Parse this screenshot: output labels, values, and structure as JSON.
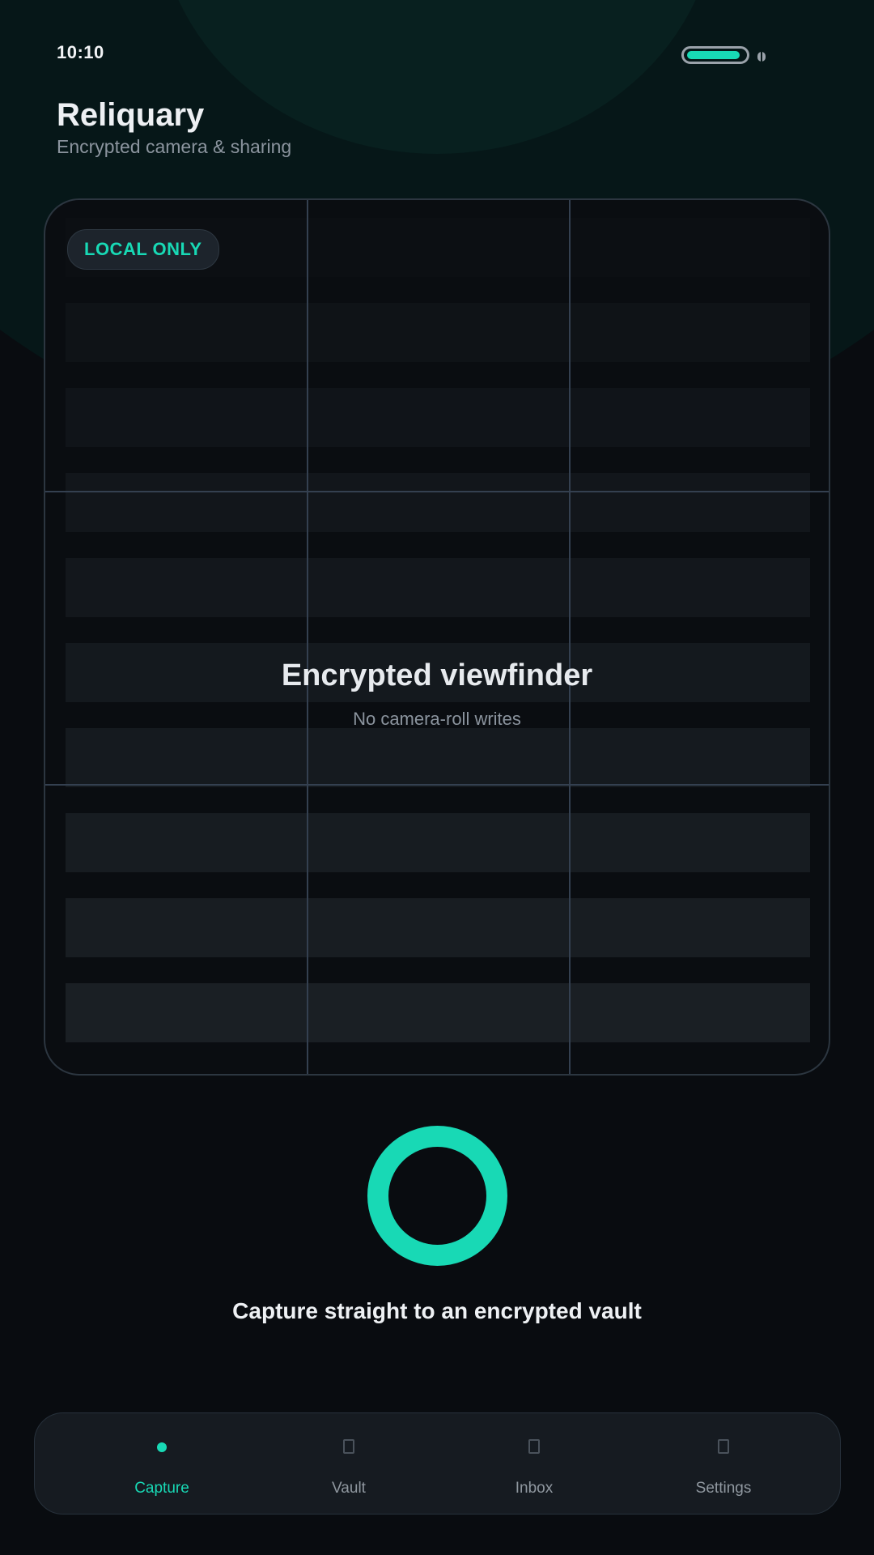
{
  "status_bar": {
    "time": "10:10",
    "battery_level": 0.9
  },
  "header": {
    "title": "Reliquary",
    "subtitle": "Encrypted camera & sharing"
  },
  "viewfinder": {
    "badge": "LOCAL ONLY",
    "title": "Encrypted viewfinder",
    "subtitle": "No camera-roll writes"
  },
  "capture": {
    "caption": "Capture straight to an encrypted vault"
  },
  "tabs": [
    {
      "label": "Capture",
      "icon": "dot-icon",
      "active": true
    },
    {
      "label": "Vault",
      "icon": "vault-icon",
      "active": false
    },
    {
      "label": "Inbox",
      "icon": "inbox-icon",
      "active": false
    },
    {
      "label": "Settings",
      "icon": "settings-icon",
      "active": false
    }
  ],
  "colors": {
    "accent": "#18d9b5",
    "background": "#090c10",
    "surface": "#161b21",
    "text_primary": "#edf0f3",
    "text_secondary": "#8b949e"
  }
}
